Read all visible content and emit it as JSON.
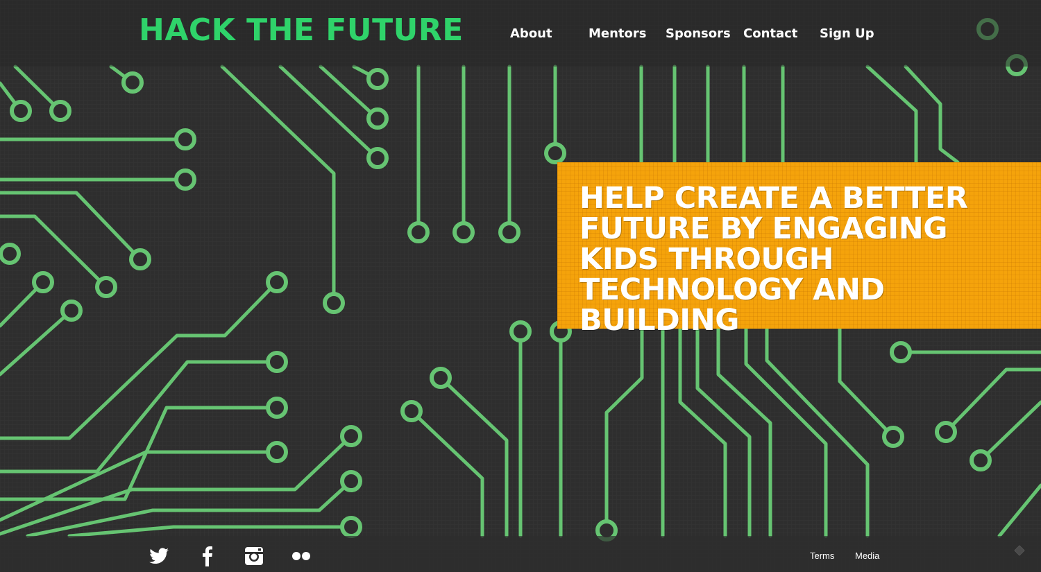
{
  "brand": {
    "logo_text": "HACK THE FUTURE",
    "accent_color": "#2fd36a"
  },
  "nav": {
    "items": [
      {
        "label": "About"
      },
      {
        "label": "Mentors"
      },
      {
        "label": "Sponsors"
      },
      {
        "label": "Contact"
      },
      {
        "label": "Sign Up"
      }
    ]
  },
  "hero": {
    "headline": "HELP CREATE A BETTER FUTURE BY ENGAGING KIDS THROUGH TECHNOLOGY AND BUILDING",
    "box_color": "#f5a30b"
  },
  "background": {
    "style": "circuit-board",
    "trace_color": "#66c472",
    "base_color": "#2f2f2f"
  },
  "footer": {
    "social": [
      {
        "icon": "twitter-icon"
      },
      {
        "icon": "facebook-icon"
      },
      {
        "icon": "instagram-icon"
      },
      {
        "icon": "flickr-icon"
      }
    ],
    "links": [
      {
        "label": "Terms"
      },
      {
        "label": "Media"
      }
    ]
  }
}
